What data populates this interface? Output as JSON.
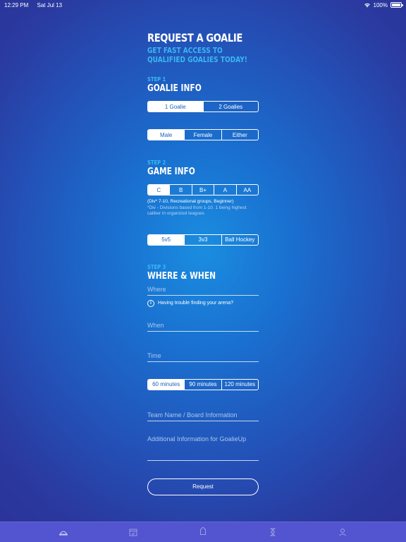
{
  "status": {
    "time": "12:29 PM",
    "date": "Sat Jul 13",
    "battery": "100%"
  },
  "header": {
    "title": "REQUEST A GOALIE",
    "subtitle": "GET FAST ACCESS TO QUALIFIED GOALIES TODAY!"
  },
  "step1": {
    "label": "STEP 1",
    "title": "GOALIE INFO",
    "count_options": [
      "1 Goalie",
      "2 Goalies"
    ],
    "count_selected": "1 Goalie",
    "gender_options": [
      "Male",
      "Female",
      "Either"
    ],
    "gender_selected": "Male"
  },
  "step2": {
    "label": "STEP 2",
    "title": "GAME INFO",
    "level_options": [
      "C",
      "B",
      "B+",
      "A",
      "AA"
    ],
    "level_selected": "C",
    "level_note": "(Div* 7-10, Recreational groups, Beginner)",
    "level_subnote": "*Div - Divisions based from 1-10. 1 being highest caliber in organized leagues",
    "format_options": [
      "5v5",
      "3v3",
      "Ball Hockey"
    ],
    "format_selected": "5v5"
  },
  "step3": {
    "label": "STEP 3",
    "title": "WHERE & WHEN",
    "where_placeholder": "Where",
    "trouble_text": "Having trouble finding your arena?",
    "when_placeholder": "When",
    "time_placeholder": "Time",
    "duration_options": [
      "60 minutes",
      "90 minutes",
      "120 minutes"
    ],
    "duration_selected": "60 minutes",
    "team_placeholder": "Team Name / Board Information",
    "additional_placeholder": "Additional Information for GoalieUp"
  },
  "request_label": "Request",
  "tabs": [
    {
      "icon": "home-icon"
    },
    {
      "icon": "calendar-icon"
    },
    {
      "icon": "tag-icon"
    },
    {
      "icon": "hourglass-icon"
    },
    {
      "icon": "profile-icon"
    }
  ],
  "colors": {
    "accent": "#39b8f2",
    "tabbar": "#5354cf",
    "selected_text": "#1e5fc0"
  }
}
